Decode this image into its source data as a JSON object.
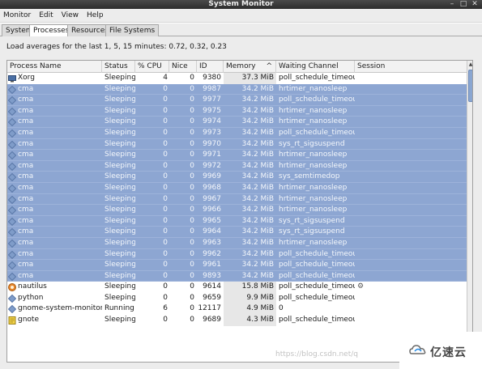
{
  "window": {
    "title": "System Monitor"
  },
  "menu": [
    "Monitor",
    "Edit",
    "View",
    "Help"
  ],
  "tabs": [
    "System",
    "Processes",
    "Resources",
    "File Systems"
  ],
  "active_tab": "Processes",
  "load_text": "Load averages for the last 1, 5, 15 minutes: 0.72, 0.32, 0.23",
  "columns": [
    "Process Name",
    "Status",
    "% CPU",
    "Nice",
    "ID",
    "Memory",
    "Waiting Channel",
    "Session"
  ],
  "sort_indicator": "^",
  "processes": [
    {
      "name": "Xorg",
      "icon": "xorg-icon",
      "status": "Sleeping",
      "cpu": "4",
      "nice": "0",
      "id": "9380",
      "memory": "37.3 MiB",
      "channel": "poll_schedule_timeout",
      "session": "",
      "selected": false
    },
    {
      "name": "cma",
      "icon": "cma-icon",
      "status": "Sleeping",
      "cpu": "0",
      "nice": "0",
      "id": "9987",
      "memory": "34.2 MiB",
      "channel": "hrtimer_nanosleep",
      "session": "",
      "selected": true
    },
    {
      "name": "cma",
      "icon": "cma-icon",
      "status": "Sleeping",
      "cpu": "0",
      "nice": "0",
      "id": "9977",
      "memory": "34.2 MiB",
      "channel": "poll_schedule_timeout",
      "session": "",
      "selected": true
    },
    {
      "name": "cma",
      "icon": "cma-icon",
      "status": "Sleeping",
      "cpu": "0",
      "nice": "0",
      "id": "9975",
      "memory": "34.2 MiB",
      "channel": "hrtimer_nanosleep",
      "session": "",
      "selected": true
    },
    {
      "name": "cma",
      "icon": "cma-icon",
      "status": "Sleeping",
      "cpu": "0",
      "nice": "0",
      "id": "9974",
      "memory": "34.2 MiB",
      "channel": "hrtimer_nanosleep",
      "session": "",
      "selected": true
    },
    {
      "name": "cma",
      "icon": "cma-icon",
      "status": "Sleeping",
      "cpu": "0",
      "nice": "0",
      "id": "9973",
      "memory": "34.2 MiB",
      "channel": "poll_schedule_timeout",
      "session": "",
      "selected": true
    },
    {
      "name": "cma",
      "icon": "cma-icon",
      "status": "Sleeping",
      "cpu": "0",
      "nice": "0",
      "id": "9970",
      "memory": "34.2 MiB",
      "channel": "sys_rt_sigsuspend",
      "session": "",
      "selected": true
    },
    {
      "name": "cma",
      "icon": "cma-icon",
      "status": "Sleeping",
      "cpu": "0",
      "nice": "0",
      "id": "9971",
      "memory": "34.2 MiB",
      "channel": "hrtimer_nanosleep",
      "session": "",
      "selected": true
    },
    {
      "name": "cma",
      "icon": "cma-icon",
      "status": "Sleeping",
      "cpu": "0",
      "nice": "0",
      "id": "9972",
      "memory": "34.2 MiB",
      "channel": "hrtimer_nanosleep",
      "session": "",
      "selected": true
    },
    {
      "name": "cma",
      "icon": "cma-icon",
      "status": "Sleeping",
      "cpu": "0",
      "nice": "0",
      "id": "9969",
      "memory": "34.2 MiB",
      "channel": "sys_semtimedop",
      "session": "",
      "selected": true
    },
    {
      "name": "cma",
      "icon": "cma-icon",
      "status": "Sleeping",
      "cpu": "0",
      "nice": "0",
      "id": "9968",
      "memory": "34.2 MiB",
      "channel": "hrtimer_nanosleep",
      "session": "",
      "selected": true
    },
    {
      "name": "cma",
      "icon": "cma-icon",
      "status": "Sleeping",
      "cpu": "0",
      "nice": "0",
      "id": "9967",
      "memory": "34.2 MiB",
      "channel": "hrtimer_nanosleep",
      "session": "",
      "selected": true
    },
    {
      "name": "cma",
      "icon": "cma-icon",
      "status": "Sleeping",
      "cpu": "0",
      "nice": "0",
      "id": "9966",
      "memory": "34.2 MiB",
      "channel": "hrtimer_nanosleep",
      "session": "",
      "selected": true
    },
    {
      "name": "cma",
      "icon": "cma-icon",
      "status": "Sleeping",
      "cpu": "0",
      "nice": "0",
      "id": "9965",
      "memory": "34.2 MiB",
      "channel": "sys_rt_sigsuspend",
      "session": "",
      "selected": true
    },
    {
      "name": "cma",
      "icon": "cma-icon",
      "status": "Sleeping",
      "cpu": "0",
      "nice": "0",
      "id": "9964",
      "memory": "34.2 MiB",
      "channel": "sys_rt_sigsuspend",
      "session": "",
      "selected": true
    },
    {
      "name": "cma",
      "icon": "cma-icon",
      "status": "Sleeping",
      "cpu": "0",
      "nice": "0",
      "id": "9963",
      "memory": "34.2 MiB",
      "channel": "hrtimer_nanosleep",
      "session": "",
      "selected": true
    },
    {
      "name": "cma",
      "icon": "cma-icon",
      "status": "Sleeping",
      "cpu": "0",
      "nice": "0",
      "id": "9962",
      "memory": "34.2 MiB",
      "channel": "poll_schedule_timeout",
      "session": "",
      "selected": true
    },
    {
      "name": "cma",
      "icon": "cma-icon",
      "status": "Sleeping",
      "cpu": "0",
      "nice": "0",
      "id": "9961",
      "memory": "34.2 MiB",
      "channel": "poll_schedule_timeout",
      "session": "",
      "selected": true
    },
    {
      "name": "cma",
      "icon": "cma-icon",
      "status": "Sleeping",
      "cpu": "0",
      "nice": "0",
      "id": "9893",
      "memory": "34.2 MiB",
      "channel": "poll_schedule_timeout",
      "session": "",
      "selected": true
    },
    {
      "name": "nautilus",
      "icon": "nautilus-icon",
      "status": "Sleeping",
      "cpu": "0",
      "nice": "0",
      "id": "9614",
      "memory": "15.8 MiB",
      "channel": "poll_schedule_timeout",
      "session": "",
      "session_icon": "session-icon",
      "selected": false
    },
    {
      "name": "python",
      "icon": "python-icon",
      "status": "Sleeping",
      "cpu": "0",
      "nice": "0",
      "id": "9659",
      "memory": "9.9 MiB",
      "channel": "poll_schedule_timeout",
      "session": "",
      "selected": false
    },
    {
      "name": "gnome-system-monitor",
      "icon": "gnome-system-monitor-icon",
      "status": "Running",
      "cpu": "6",
      "nice": "0",
      "id": "12117",
      "memory": "4.9 MiB",
      "channel": "0",
      "session": "",
      "selected": false
    },
    {
      "name": "gnote",
      "icon": "gnote-icon",
      "status": "Sleeping",
      "cpu": "0",
      "nice": "0",
      "id": "9689",
      "memory": "4.3 MiB",
      "channel": "poll_schedule_timeout",
      "session": "",
      "selected": false
    }
  ],
  "watermark": "https://blog.csdn.net/q",
  "brand": {
    "name": "亿速云",
    "logo_icon": "cloud-logo-icon"
  },
  "colors": {
    "selection": "#8da6d2",
    "titlebar": "#3a3a3a"
  }
}
